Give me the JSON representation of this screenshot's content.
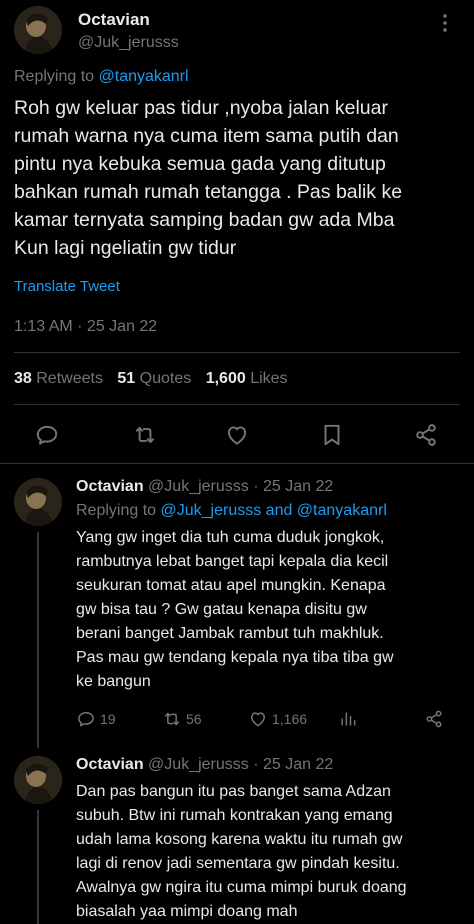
{
  "main_tweet": {
    "author_name": "Octavian",
    "author_handle": "@Juk_jerusss",
    "replying_prefix": "Replying to",
    "replying_to": "@tanyakanrl",
    "text_lines": [
      "Roh gw keluar pas tidur ,nyoba jalan keluar",
      "rumah warna nya cuma item sama putih dan",
      "pintu nya kebuka semua gada yang ditutup",
      "bahkan rumah rumah tetangga . Pas balik ke",
      "kamar ternyata samping badan gw ada Mba",
      "Kun lagi ngeliatin gw tidur"
    ],
    "translate_label": "Translate Tweet",
    "timestamp": "1:13 AM · 25 Jan 22",
    "stats": {
      "retweets_count": "38",
      "retweets_label": "Retweets",
      "quotes_count": "51",
      "quotes_label": "Quotes",
      "likes_count": "1,600",
      "likes_label": "Likes"
    },
    "actions": [
      "reply-icon",
      "retweet-icon",
      "like-icon",
      "bookmark-icon",
      "share-icon"
    ]
  },
  "replies": [
    {
      "author_name": "Octavian",
      "meta": "@Juk_jerusss · 25 Jan 22",
      "replying_prefix": "Replying to",
      "replying_to": "@Juk_jerusss and @tanyakanrl",
      "text_lines": [
        "Yang gw inget dia tuh cuma duduk jongkok,",
        "rambutnya lebat banget tapi kepala dia kecil",
        "seukuran tomat atau apel mungkin. Kenapa",
        "gw bisa tau ? Gw gatau kenapa disitu gw",
        "berani banget Jambak rambut tuh makhluk.",
        "Pas mau gw tendang kepala nya tiba tiba gw",
        "ke bangun"
      ],
      "reply_count": "19",
      "retweet_count": "56",
      "like_count": "1,166"
    },
    {
      "author_name": "Octavian",
      "meta": "@Juk_jerusss · 25 Jan 22",
      "text_lines": [
        "Dan pas bangun itu pas banget sama Adzan",
        "subuh. Btw ini rumah kontrakan yang emang",
        "udah lama kosong karena waktu itu rumah gw",
        "lagi di renov jadi sementara gw pindah kesitu.",
        "Awalnya gw ngira itu cuma mimpi buruk doang",
        "biasalah yaa mimpi doang mah"
      ]
    }
  ],
  "colors": {
    "background": "#000000",
    "text": "#e7e9ea",
    "muted": "#71767b",
    "accent": "#1d9bf0",
    "divider": "#2f3336"
  }
}
